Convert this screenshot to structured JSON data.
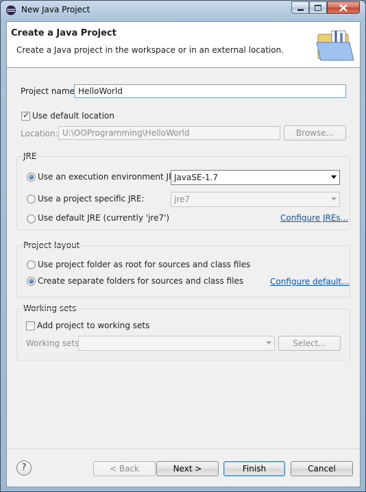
{
  "window": {
    "title": "New Java Project",
    "icon": "eclipse-icon"
  },
  "banner": {
    "title": "Create a Java Project",
    "description": "Create a Java project in the workspace or in an external location.",
    "image": "java-project-folder-icon"
  },
  "project": {
    "name_label": "Project name:",
    "name_value": "HelloWorld",
    "use_default_location_label": "Use default location",
    "use_default_location_checked": true,
    "location_label": "Location:",
    "location_value": "U:\\OOProgramming\\HelloWorld",
    "browse_label": "Browse..."
  },
  "jre": {
    "group_label": "JRE",
    "options": [
      {
        "label": "Use an execution environment JRE:",
        "selected": true
      },
      {
        "label": "Use a project specific JRE:",
        "selected": false
      },
      {
        "label": "Use default JRE (currently 'jre7')",
        "selected": false
      }
    ],
    "env_value": "JavaSE-1.7",
    "specific_value": "jre7",
    "configure_link": "Configure JREs..."
  },
  "layout": {
    "group_label": "Project layout",
    "options": [
      {
        "label": "Use project folder as root for sources and class files",
        "selected": false
      },
      {
        "label": "Create separate folders for sources and class files",
        "selected": true
      }
    ],
    "configure_link": "Configure default..."
  },
  "working_sets": {
    "group_label": "Working sets",
    "add_label": "Add project to working sets",
    "add_checked": false,
    "sets_label": "Working sets:",
    "sets_value": "",
    "select_label": "Select..."
  },
  "footer": {
    "help": "?",
    "back": "< Back",
    "next": "Next >",
    "finish": "Finish",
    "cancel": "Cancel"
  }
}
